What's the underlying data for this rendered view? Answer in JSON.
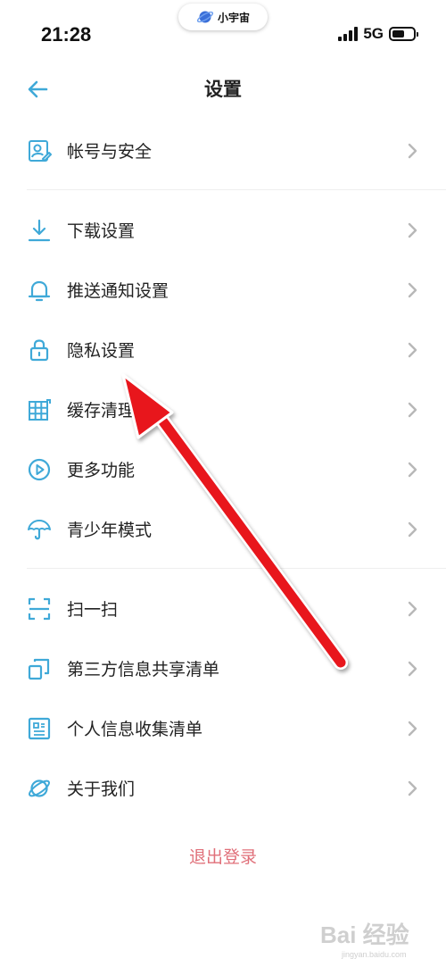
{
  "status": {
    "time": "21:28",
    "island_label": "小宇宙",
    "network": "5G",
    "battery_level": 0.6
  },
  "header": {
    "title": "设置",
    "back_icon": "arrow-left-icon"
  },
  "groups": [
    [
      {
        "label": "帐号与安全",
        "icon": "account-security-icon"
      }
    ],
    [
      {
        "label": "下载设置",
        "icon": "download-icon"
      },
      {
        "label": "推送通知设置",
        "icon": "bell-icon"
      },
      {
        "label": "隐私设置",
        "icon": "lock-icon"
      },
      {
        "label": "缓存清理",
        "icon": "grid-icon"
      },
      {
        "label": "更多功能",
        "icon": "play-circle-icon"
      },
      {
        "label": "青少年模式",
        "icon": "umbrella-icon"
      }
    ],
    [
      {
        "label": "扫一扫",
        "icon": "scan-icon"
      },
      {
        "label": "第三方信息共享清单",
        "icon": "copy-icon"
      },
      {
        "label": "个人信息收集清单",
        "icon": "document-list-icon"
      },
      {
        "label": "关于我们",
        "icon": "planet-icon"
      }
    ]
  ],
  "logout_label": "退出登录",
  "watermark": {
    "text": "Bai 经验",
    "sub": "jingyan.baidu.com"
  },
  "colors": {
    "accent": "#3fa9d8",
    "chevron": "#b8b8b8",
    "logout": "#e0707a",
    "annotation_arrow": "#e8121f"
  }
}
